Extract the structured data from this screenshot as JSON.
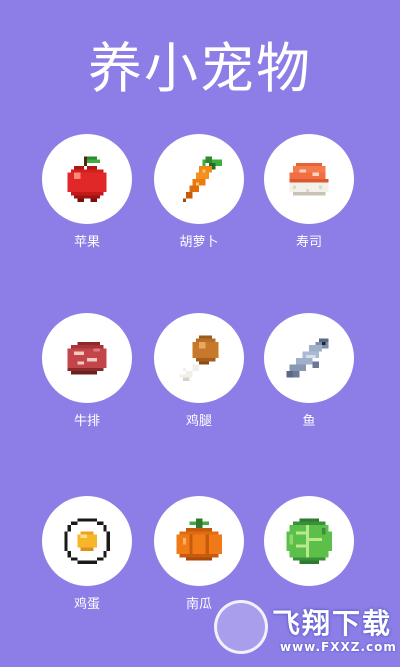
{
  "title": "养小宠物",
  "foods": [
    {
      "label": "苹果",
      "icon": "apple-icon"
    },
    {
      "label": "胡萝卜",
      "icon": "carrot-icon"
    },
    {
      "label": "寿司",
      "icon": "sushi-icon"
    },
    {
      "label": "牛排",
      "icon": "steak-icon"
    },
    {
      "label": "鸡腿",
      "icon": "chicken-leg-icon"
    },
    {
      "label": "鱼",
      "icon": "fish-icon"
    },
    {
      "label": "鸡蛋",
      "icon": "fried-egg-icon"
    },
    {
      "label": "南瓜",
      "icon": "pumpkin-icon"
    },
    {
      "label": "",
      "icon": "cabbage-icon"
    }
  ],
  "watermark": {
    "brand": "飞翔下载",
    "url": "www.FXXZ.com"
  },
  "colors": {
    "background": "#8c7ee6",
    "circle": "#ffffff",
    "text": "#ffffff"
  }
}
